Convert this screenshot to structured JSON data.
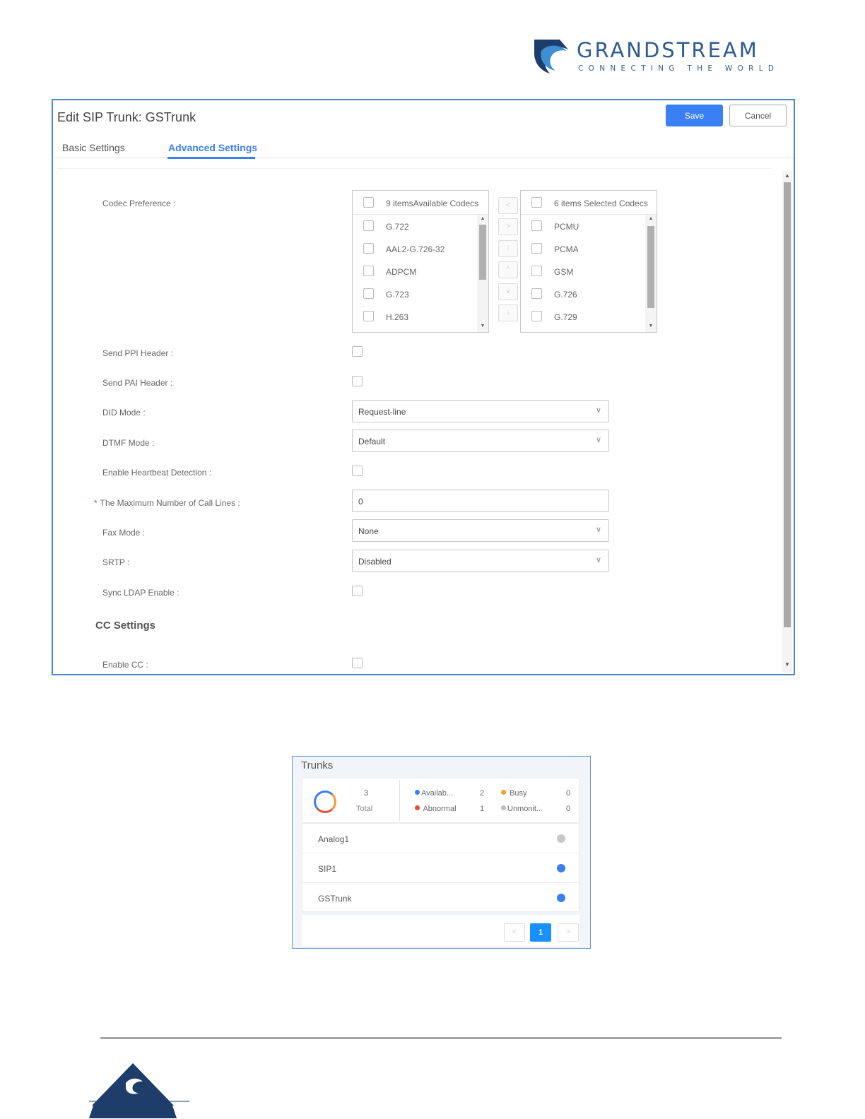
{
  "brand": {
    "name": "GRANDSTREAM",
    "tagline": "CONNECTING THE WORLD",
    "colors": {
      "primary": "#2e5c8f",
      "accent": "#3b7ff5"
    }
  },
  "editor": {
    "title": "Edit SIP Trunk: GSTrunk",
    "save_label": "Save",
    "cancel_label": "Cancel",
    "tabs": [
      {
        "label": "Basic Settings",
        "active": false
      },
      {
        "label": "Advanced Settings",
        "active": true
      }
    ]
  },
  "codec": {
    "label": "Codec Preference",
    "available_header": "9 itemsAvailable Codecs",
    "selected_header": "6 items Selected Codecs",
    "available": [
      "G.722",
      "AAL2-G.726-32",
      "ADPCM",
      "G.723",
      "H.263"
    ],
    "selected": [
      "PCMU",
      "PCMA",
      "GSM",
      "G.726",
      "G.729"
    ],
    "move_buttons": [
      "<",
      ">",
      "↑",
      "^",
      "v",
      "↓"
    ]
  },
  "fields": {
    "send_ppi": {
      "label": "Send PPI Header",
      "checked": false
    },
    "send_pai": {
      "label": "Send PAI Header",
      "checked": false
    },
    "did_mode": {
      "label": "DID Mode",
      "value": "Request-line"
    },
    "dtmf_mode": {
      "label": "DTMF Mode",
      "value": "Default"
    },
    "heartbeat": {
      "label": "Enable Heartbeat Detection",
      "checked": false
    },
    "max_call_lines": {
      "label": "The Maximum Number of Call Lines",
      "value": "0",
      "required_mark": "*"
    },
    "fax_mode": {
      "label": "Fax Mode",
      "value": "None"
    },
    "srtp": {
      "label": "SRTP",
      "value": "Disabled"
    },
    "sync_ldap": {
      "label": "Sync LDAP Enable",
      "checked": false
    }
  },
  "cc_settings": {
    "heading": "CC Settings",
    "enable_cc": {
      "label": "Enable CC",
      "checked": false
    }
  },
  "trunks_widget": {
    "title": "Trunks",
    "total_count": "3",
    "total_label": "Total",
    "legend": [
      {
        "label": "Availab...",
        "count": "2",
        "color": "#3b7ff5"
      },
      {
        "label": "Busy",
        "count": "0",
        "color": "#f0a030"
      },
      {
        "label": "Abnormal",
        "count": "1",
        "color": "#e84c3d"
      },
      {
        "label": "Unmonit...",
        "count": "0",
        "color": "#bdbdbd"
      }
    ],
    "rows": [
      {
        "name": "Analog1",
        "status_color": "#c8c8c8"
      },
      {
        "name": "SIP1",
        "status_color": "#3b7ff5"
      },
      {
        "name": "GSTrunk",
        "status_color": "#3b7ff5"
      }
    ],
    "pager": {
      "prev": "<",
      "current": "1",
      "next": ">"
    }
  }
}
